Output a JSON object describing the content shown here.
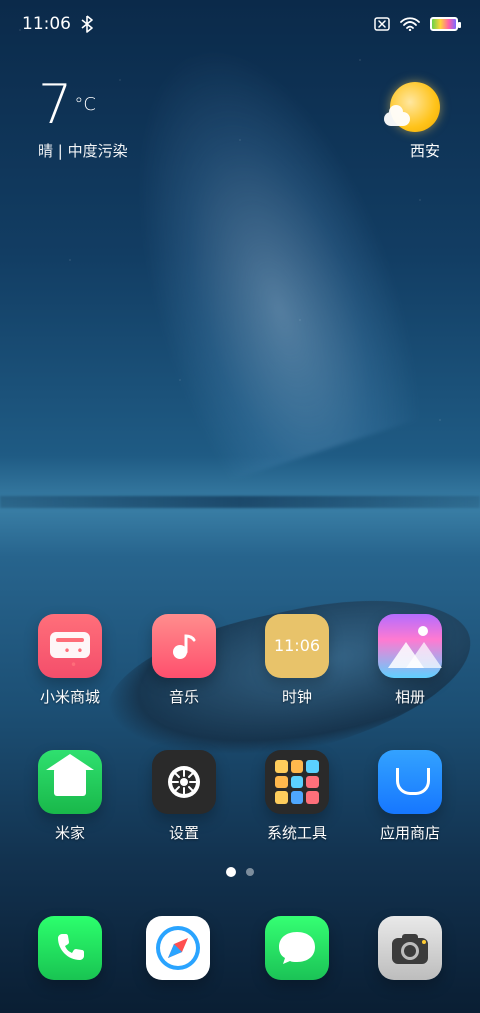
{
  "status": {
    "time": "11:06"
  },
  "weather": {
    "temp": "7",
    "unit": "°C",
    "condition": "晴 | 中度污染",
    "city": "西安"
  },
  "apps": [
    {
      "name": "xiaomi-mall",
      "label": "小米商城"
    },
    {
      "name": "music",
      "label": "音乐"
    },
    {
      "name": "clock",
      "label": "时钟",
      "time": "11:06"
    },
    {
      "name": "gallery",
      "label": "相册"
    },
    {
      "name": "mi-home",
      "label": "米家"
    },
    {
      "name": "settings",
      "label": "设置"
    },
    {
      "name": "system-tools",
      "label": "系统工具"
    },
    {
      "name": "app-store",
      "label": "应用商店"
    }
  ],
  "pager": {
    "active_page": 1,
    "page_count": 2
  },
  "dock": [
    {
      "name": "phone",
      "icon": "phone-icon"
    },
    {
      "name": "browser",
      "icon": "compass-icon"
    },
    {
      "name": "messages",
      "icon": "message-bubble-icon"
    },
    {
      "name": "camera",
      "icon": "camera-icon"
    }
  ]
}
